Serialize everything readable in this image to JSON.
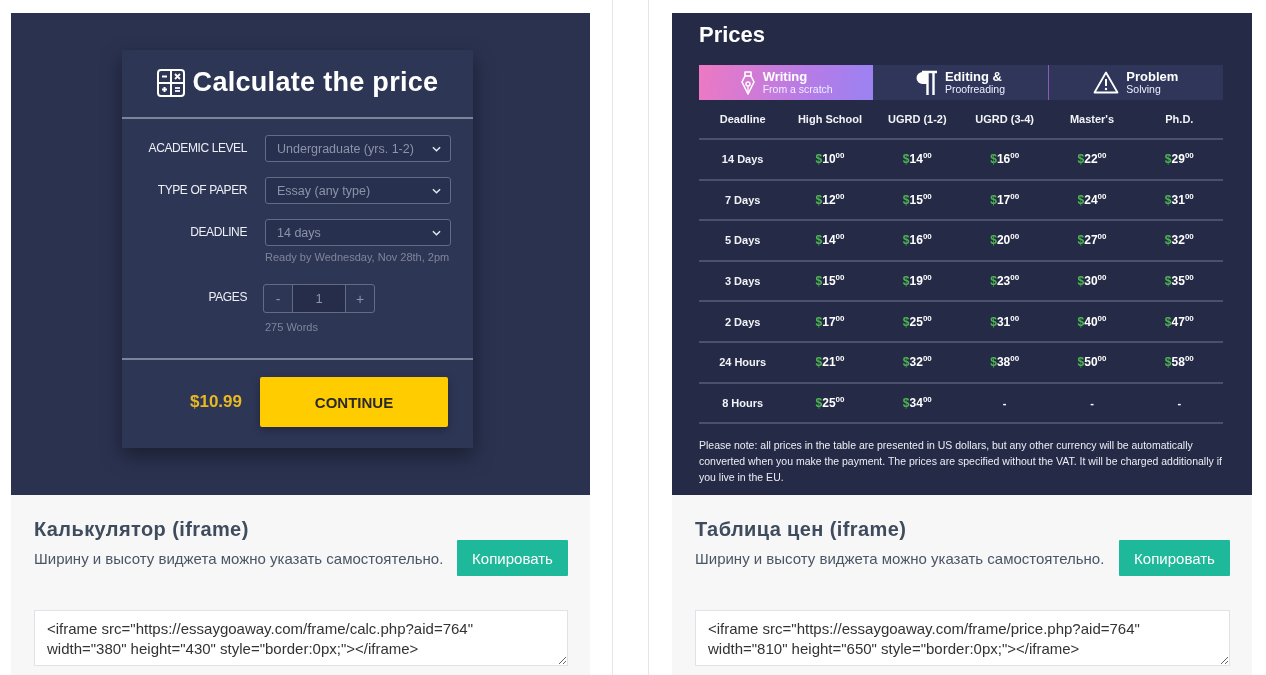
{
  "widgets": [
    {
      "kind": "calculator",
      "calculator": {
        "title": "Calculate the price",
        "fields": [
          {
            "kind": "select",
            "label": "ACADEMIC LEVEL",
            "value": "Undergraduate (yrs. 1-2)"
          },
          {
            "kind": "select",
            "label": "TYPE OF PAPER",
            "value": "Essay (any type)"
          },
          {
            "kind": "select",
            "label": "DEADLINE",
            "value": "14 days",
            "hint": "Ready by Wednesday, Nov 28th, 2pm"
          },
          {
            "kind": "stepper",
            "label": "PAGES",
            "decrement": "-",
            "value": "1",
            "increment": "+",
            "hint": "275 Words"
          }
        ],
        "price": "$10.99",
        "button": "CONTINUE"
      },
      "title": "Калькулятор (iframe)",
      "description": "Ширину и высоту виджета можно указать самостоятельно.",
      "button": "Копировать",
      "code": "<iframe src=\"https://essaygoaway.com/frame/calc.php?aid=764\" width=\"380\" height=\"430\" style=\"border:0px;\"></iframe>"
    },
    {
      "kind": "price_table",
      "price_table": {
        "title": "Prices",
        "tabs": [
          {
            "title": "Writing",
            "subtitle": "From a scratch",
            "selected": true
          },
          {
            "title": "Editing &",
            "subtitle": "Proofreading",
            "selected": false
          },
          {
            "title": "Problem",
            "subtitle": "Solving",
            "selected": false
          }
        ],
        "columns": [
          "Deadline",
          "High School",
          "UGRD (1-2)",
          "UGRD (3-4)",
          "Master's",
          "Ph.D."
        ],
        "rows": [
          {
            "cells": [
              {
                "kind": "deadline",
                "text": "14 Days"
              },
              {
                "kind": "price",
                "currency": "$",
                "amount": "10",
                "cents": "00"
              },
              {
                "kind": "price",
                "currency": "$",
                "amount": "14",
                "cents": "00"
              },
              {
                "kind": "price",
                "currency": "$",
                "amount": "16",
                "cents": "00"
              },
              {
                "kind": "price",
                "currency": "$",
                "amount": "22",
                "cents": "00"
              },
              {
                "kind": "price",
                "currency": "$",
                "amount": "29",
                "cents": "00"
              }
            ]
          },
          {
            "cells": [
              {
                "kind": "deadline",
                "text": "7 Days"
              },
              {
                "kind": "price",
                "currency": "$",
                "amount": "12",
                "cents": "00"
              },
              {
                "kind": "price",
                "currency": "$",
                "amount": "15",
                "cents": "00"
              },
              {
                "kind": "price",
                "currency": "$",
                "amount": "17",
                "cents": "00"
              },
              {
                "kind": "price",
                "currency": "$",
                "amount": "24",
                "cents": "00"
              },
              {
                "kind": "price",
                "currency": "$",
                "amount": "31",
                "cents": "00"
              }
            ]
          },
          {
            "cells": [
              {
                "kind": "deadline",
                "text": "5 Days"
              },
              {
                "kind": "price",
                "currency": "$",
                "amount": "14",
                "cents": "00"
              },
              {
                "kind": "price",
                "currency": "$",
                "amount": "16",
                "cents": "00"
              },
              {
                "kind": "price",
                "currency": "$",
                "amount": "20",
                "cents": "00"
              },
              {
                "kind": "price",
                "currency": "$",
                "amount": "27",
                "cents": "00"
              },
              {
                "kind": "price",
                "currency": "$",
                "amount": "32",
                "cents": "00"
              }
            ]
          },
          {
            "cells": [
              {
                "kind": "deadline",
                "text": "3 Days"
              },
              {
                "kind": "price",
                "currency": "$",
                "amount": "15",
                "cents": "00"
              },
              {
                "kind": "price",
                "currency": "$",
                "amount": "19",
                "cents": "00"
              },
              {
                "kind": "price",
                "currency": "$",
                "amount": "23",
                "cents": "00"
              },
              {
                "kind": "price",
                "currency": "$",
                "amount": "30",
                "cents": "00"
              },
              {
                "kind": "price",
                "currency": "$",
                "amount": "35",
                "cents": "00"
              }
            ]
          },
          {
            "cells": [
              {
                "kind": "deadline",
                "text": "2 Days"
              },
              {
                "kind": "price",
                "currency": "$",
                "amount": "17",
                "cents": "00"
              },
              {
                "kind": "price",
                "currency": "$",
                "amount": "25",
                "cents": "00"
              },
              {
                "kind": "price",
                "currency": "$",
                "amount": "31",
                "cents": "00"
              },
              {
                "kind": "price",
                "currency": "$",
                "amount": "40",
                "cents": "00"
              },
              {
                "kind": "price",
                "currency": "$",
                "amount": "47",
                "cents": "00"
              }
            ]
          },
          {
            "cells": [
              {
                "kind": "deadline",
                "text": "24 Hours"
              },
              {
                "kind": "price",
                "currency": "$",
                "amount": "21",
                "cents": "00"
              },
              {
                "kind": "price",
                "currency": "$",
                "amount": "32",
                "cents": "00"
              },
              {
                "kind": "price",
                "currency": "$",
                "amount": "38",
                "cents": "00"
              },
              {
                "kind": "price",
                "currency": "$",
                "amount": "50",
                "cents": "00"
              },
              {
                "kind": "price",
                "currency": "$",
                "amount": "58",
                "cents": "00"
              }
            ]
          },
          {
            "cells": [
              {
                "kind": "deadline",
                "text": "8 Hours"
              },
              {
                "kind": "price",
                "currency": "$",
                "amount": "25",
                "cents": "00"
              },
              {
                "kind": "price",
                "currency": "$",
                "amount": "34",
                "cents": "00"
              },
              {
                "kind": "none",
                "text": "-"
              },
              {
                "kind": "none",
                "text": "-"
              },
              {
                "kind": "none",
                "text": "-"
              }
            ]
          }
        ],
        "note": "Please note: all prices in the table are presented in US dollars, but any other currency will be automatically converted when you make the payment. The prices are specified without the VAT. It will be charged additionally if you live in the EU."
      },
      "title": "Таблица цен (iframe)",
      "description": "Ширину и высоту виджета можно указать самостоятельно.",
      "button": "Копировать",
      "code": "<iframe src=\"https://essaygoaway.com/frame/price.php?aid=764\" width=\"810\" height=\"650\" style=\"border:0px;\"></iframe>"
    }
  ]
}
